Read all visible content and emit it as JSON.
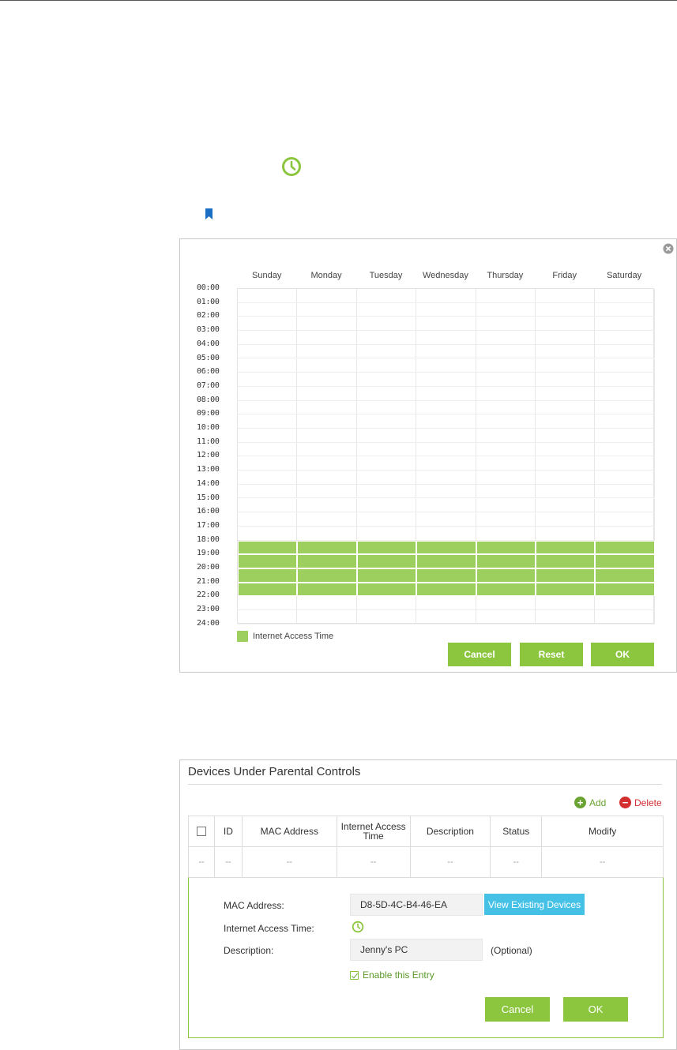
{
  "schedule": {
    "days": [
      "Sunday",
      "Monday",
      "Tuesday",
      "Wednesday",
      "Thursday",
      "Friday",
      "Saturday"
    ],
    "times": [
      "00:00",
      "01:00",
      "02:00",
      "03:00",
      "04:00",
      "05:00",
      "06:00",
      "07:00",
      "08:00",
      "09:00",
      "10:00",
      "11:00",
      "12:00",
      "13:00",
      "14:00",
      "15:00",
      "16:00",
      "17:00",
      "18:00",
      "19:00",
      "20:00",
      "21:00",
      "22:00",
      "23:00",
      "24:00"
    ],
    "selected_hours_all_days": [
      18,
      19,
      20,
      21
    ],
    "legend_label": "Internet Access Time",
    "buttons": {
      "cancel": "Cancel",
      "reset": "Reset",
      "ok": "OK"
    },
    "accent_color": "#9dcf5e"
  },
  "devices": {
    "title": "Devices Under Parental Controls",
    "actions": {
      "add": "Add",
      "delete": "Delete"
    },
    "columns": [
      "ID",
      "MAC Address",
      "Internet Access Time",
      "Description",
      "Status",
      "Modify"
    ],
    "row": [
      "--",
      "--",
      "--",
      "--",
      "--",
      "--",
      "--"
    ],
    "form": {
      "mac_label": "MAC Address:",
      "mac_value": "D8-5D-4C-B4-46-EA",
      "view_button": "View Existing Devices",
      "time_label": "Internet Access Time:",
      "desc_label": "Description:",
      "desc_value": "Jenny's PC",
      "optional": "(Optional)",
      "enable_label": "Enable this Entry",
      "cancel": "Cancel",
      "ok": "OK"
    }
  }
}
